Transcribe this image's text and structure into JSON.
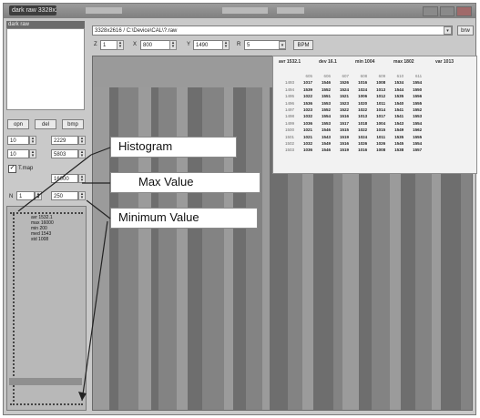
{
  "window": {
    "title": "dark raw 3328x2616",
    "controls": [
      "minimize",
      "maximize",
      "close"
    ]
  },
  "file_list": {
    "header": "dark raw"
  },
  "toolbar": {
    "path_value": "3328x2616 / C:\\Device\\CAL\\?.raw",
    "browse_label": "brw",
    "z_label": "Z",
    "z_value": "1",
    "x_label": "X",
    "x_value": "800",
    "y_label": "Y",
    "y_value": "1490",
    "r_label": "R",
    "r_value": "5",
    "apply_label": "BPM"
  },
  "left_buttons": {
    "open_label": "opn",
    "del_label": "del",
    "bmp_label": "bmp",
    "field1_value": "10",
    "field2_value": "2229",
    "field3_value": "10",
    "field4_value": "5803",
    "checkbox_label": "T.map",
    "checkbox_checked": true,
    "max_value": "16000",
    "n_label": "N",
    "n_value": "1",
    "min_value": "250"
  },
  "histogram_stats": {
    "lines": [
      "avr 1532.1",
      "max 16000",
      "min 200",
      "med 1543",
      "std 1008"
    ]
  },
  "stats_header": {
    "avr_label": "avr",
    "avr_value": "1532.1",
    "dev_label": "dev",
    "dev_value": "16.1",
    "min_label": "min",
    "min_value": "1004",
    "max_label": "max",
    "max_value": "1802",
    "var_label": "var",
    "var_value": "1013"
  },
  "stats_table": {
    "columns": [
      "605",
      "606",
      "607",
      "608",
      "609",
      "610",
      "611"
    ],
    "rows": [
      {
        "label": "1493",
        "values": [
          "1017",
          "1546",
          "1526",
          "1016",
          "1008",
          "1534",
          "1554"
        ]
      },
      {
        "label": "1494",
        "values": [
          "1539",
          "1552",
          "1524",
          "1024",
          "1013",
          "1544",
          "1550"
        ]
      },
      {
        "label": "1495",
        "values": [
          "1022",
          "1551",
          "1521",
          "1006",
          "1012",
          "1535",
          "1556"
        ]
      },
      {
        "label": "1496",
        "values": [
          "1536",
          "1553",
          "1523",
          "1020",
          "1011",
          "1540",
          "1555"
        ]
      },
      {
        "label": "1497",
        "values": [
          "1023",
          "1552",
          "1522",
          "1022",
          "1014",
          "1541",
          "1552"
        ]
      },
      {
        "label": "1498",
        "values": [
          "1032",
          "1554",
          "1516",
          "1013",
          "1017",
          "1541",
          "1553"
        ]
      },
      {
        "label": "1499",
        "values": [
          "1036",
          "1553",
          "1517",
          "1018",
          "1004",
          "1543",
          "1554"
        ]
      },
      {
        "label": "1500",
        "values": [
          "1021",
          "1546",
          "1515",
          "1022",
          "1015",
          "1549",
          "1562"
        ]
      },
      {
        "label": "1501",
        "values": [
          "1021",
          "1543",
          "1519",
          "1024",
          "1011",
          "1535",
          "1555"
        ]
      },
      {
        "label": "1502",
        "values": [
          "1032",
          "1549",
          "1516",
          "1026",
          "1026",
          "1545",
          "1554"
        ]
      },
      {
        "label": "1503",
        "values": [
          "1036",
          "1546",
          "1519",
          "1016",
          "1008",
          "1538",
          "1557"
        ]
      }
    ]
  },
  "callouts": {
    "histogram": "Histogram",
    "max_value": "Max Value",
    "minimum_value": "Minimum Value"
  },
  "colors": {
    "image_base": "#838383",
    "stripe_light": "#9b9b9b",
    "stripe_dark": "#6e6e6e",
    "window_bg": "#c9c9c9"
  }
}
